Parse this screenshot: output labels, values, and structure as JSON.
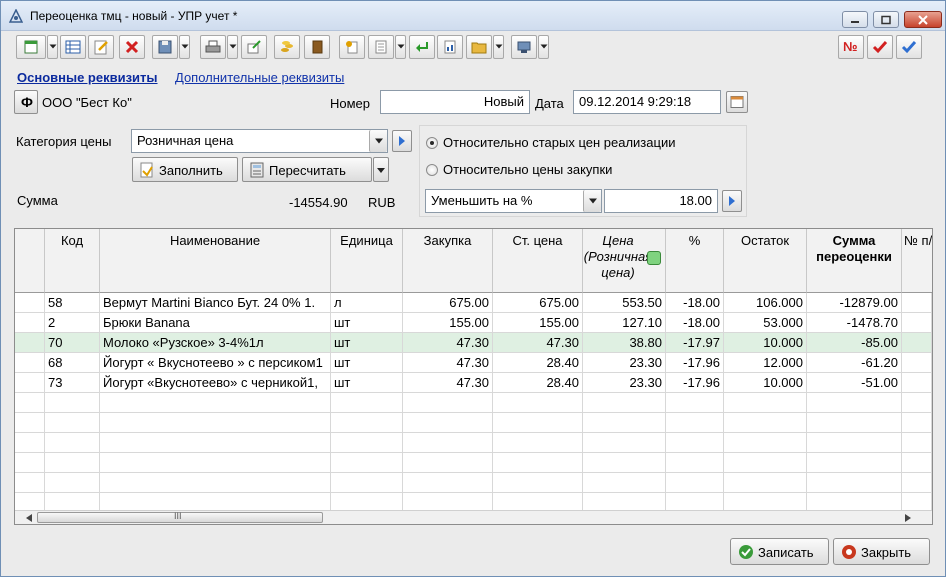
{
  "window": {
    "title": "Переоценка тмц - новый - УПР учет *"
  },
  "toolbar_right": {
    "no_label": "№"
  },
  "tabs": [
    {
      "label": "Основные реквизиты"
    },
    {
      "label": "Дополнительные реквизиты"
    }
  ],
  "header": {
    "org_button": "Ф",
    "organization": "ООО \"Бест Ко\"",
    "number_label": "Номер",
    "number_value": "Новый",
    "date_label": "Дата",
    "date_value": "09.12.2014 9:29:18"
  },
  "price_category": {
    "label": "Категория цены",
    "value": "Розничная цена"
  },
  "buttons": {
    "fill": "Заполнить",
    "recalculate": "Пересчитать"
  },
  "sum": {
    "label": "Сумма",
    "value": "-14554.90",
    "currency": "RUB"
  },
  "options": {
    "relative_old": "Относительно старых цен реализации",
    "relative_purchase": "Относительно цены закупки",
    "mode": "Уменьшить на %",
    "percent": "18.00",
    "selected": "relative_old"
  },
  "table": {
    "columns": {
      "code": "Код",
      "name": "Наименование",
      "unit": "Единица",
      "purchase": "Закупка",
      "old_price": "Ст. цена",
      "new_price": "Цена (Розничная цена)",
      "percent": "%",
      "remainder": "Остаток",
      "sum": "Сумма переоценки",
      "extra": "№ п/п"
    },
    "rows": [
      {
        "code": "58",
        "name": "Вермут Martini Bianco Бут. 24 0% 1.",
        "unit": "л",
        "purchase": "675.00",
        "old_price": "675.00",
        "new_price": "553.50",
        "percent": "-18.00",
        "remainder": "106.000",
        "sum": "-12879.00"
      },
      {
        "code": "2",
        "name": "Брюки Banana",
        "unit": "шт",
        "purchase": "155.00",
        "old_price": "155.00",
        "new_price": "127.10",
        "percent": "-18.00",
        "remainder": "53.000",
        "sum": "-1478.70"
      },
      {
        "code": "70",
        "name": "Молоко «Рузское» 3-4%1л",
        "unit": "шт",
        "purchase": "47.30",
        "old_price": "47.30",
        "new_price": "38.80",
        "percent": "-17.97",
        "remainder": "10.000",
        "sum": "-85.00"
      },
      {
        "code": "68",
        "name": "Йогурт « Вкуснотеево » с персиком1",
        "unit": "шт",
        "purchase": "47.30",
        "old_price": "28.40",
        "new_price": "23.30",
        "percent": "-17.96",
        "remainder": "12.000",
        "sum": "-61.20"
      },
      {
        "code": "73",
        "name": "Йогурт «Вкуснотеево» с черникой1,",
        "unit": "шт",
        "purchase": "47.30",
        "old_price": "28.40",
        "new_price": "23.30",
        "percent": "-17.96",
        "remainder": "10.000",
        "sum": "-51.00"
      }
    ],
    "selected_row": 2,
    "scroll_grip": "III"
  },
  "footer": {
    "save": "Записать",
    "close": "Закрыть"
  },
  "colors": {
    "link": "#1133aa",
    "selected_row": "#dff0e2",
    "accent_blue": "#2f6fd1",
    "danger_red": "#d22020"
  }
}
